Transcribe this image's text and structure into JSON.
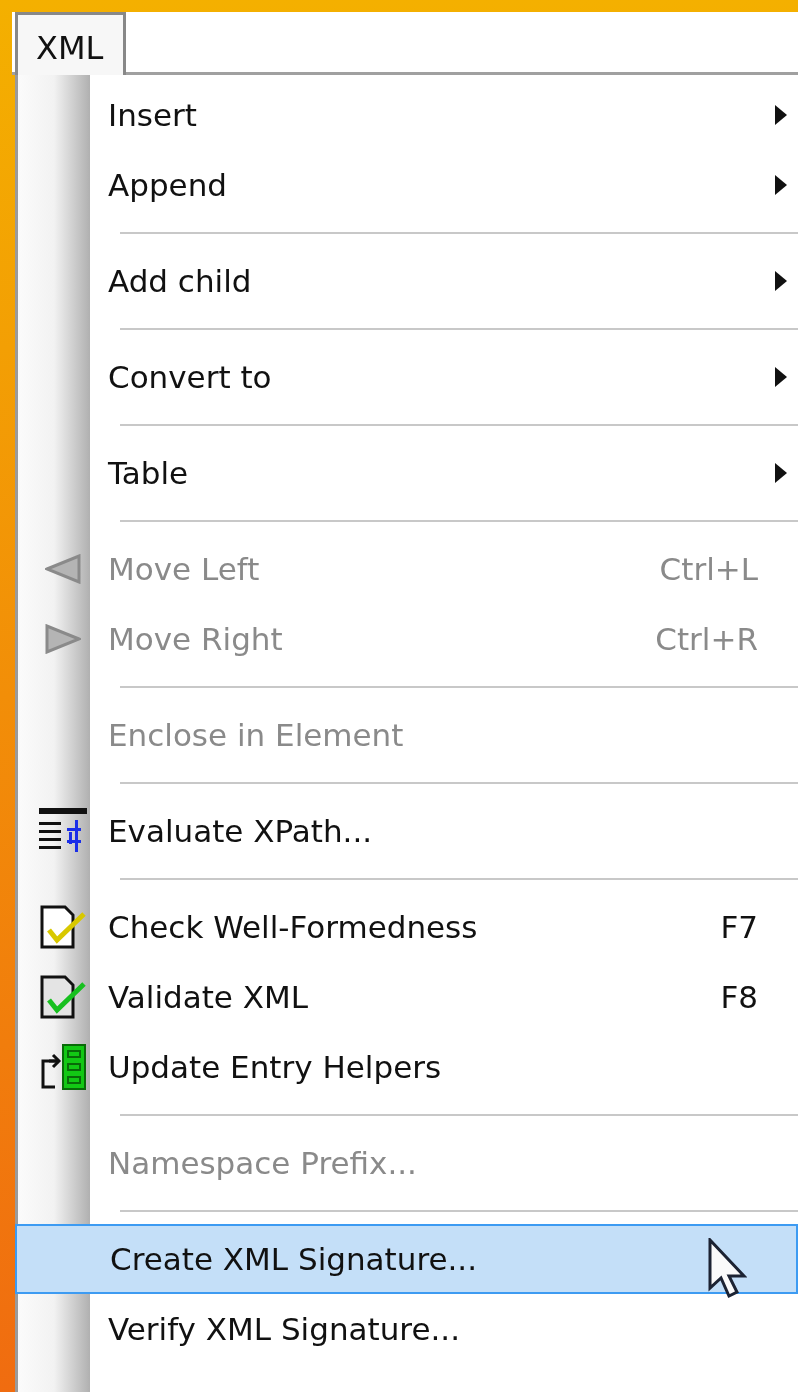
{
  "menu_bar": [
    {
      "label": "XML",
      "selected": true
    }
  ],
  "menu": [
    {
      "kind": "item",
      "label": "Insert",
      "submenu": true,
      "disabled": false,
      "selected": false
    },
    {
      "kind": "item",
      "label": "Append",
      "submenu": true,
      "disabled": false,
      "selected": false
    },
    {
      "kind": "separator"
    },
    {
      "kind": "item",
      "label": "Add child",
      "submenu": true,
      "disabled": false,
      "selected": false
    },
    {
      "kind": "separator"
    },
    {
      "kind": "item",
      "label": "Convert to",
      "submenu": true,
      "disabled": false,
      "selected": false
    },
    {
      "kind": "separator"
    },
    {
      "kind": "item",
      "label": "Table",
      "submenu": true,
      "disabled": false,
      "selected": false
    },
    {
      "kind": "separator"
    },
    {
      "kind": "item",
      "label": "Move Left",
      "shortcut": "Ctrl+L",
      "submenu": false,
      "disabled": true,
      "selected": false
    },
    {
      "kind": "item",
      "label": "Move Right",
      "shortcut": "Ctrl+R",
      "submenu": false,
      "disabled": true,
      "selected": false
    },
    {
      "kind": "separator"
    },
    {
      "kind": "item",
      "label": "Enclose in Element",
      "submenu": false,
      "disabled": true,
      "selected": false
    },
    {
      "kind": "separator"
    },
    {
      "kind": "item",
      "label": "Evaluate XPath...",
      "submenu": false,
      "disabled": false,
      "selected": false
    },
    {
      "kind": "separator"
    },
    {
      "kind": "item",
      "label": "Check Well-Formedness",
      "shortcut": "F7",
      "submenu": false,
      "disabled": false,
      "selected": false
    },
    {
      "kind": "item",
      "label": "Validate XML",
      "shortcut": "F8",
      "submenu": false,
      "disabled": false,
      "selected": false
    },
    {
      "kind": "item",
      "label": "Update Entry Helpers",
      "submenu": false,
      "disabled": false,
      "selected": false
    },
    {
      "kind": "separator"
    },
    {
      "kind": "item",
      "label": "Namespace Prefix...",
      "submenu": false,
      "disabled": true,
      "selected": false
    },
    {
      "kind": "separator"
    },
    {
      "kind": "item",
      "label": "Create XML Signature...",
      "submenu": false,
      "disabled": false,
      "selected": true
    },
    {
      "kind": "item",
      "label": "Verify XML Signature...",
      "submenu": false,
      "disabled": false,
      "selected": false
    }
  ]
}
